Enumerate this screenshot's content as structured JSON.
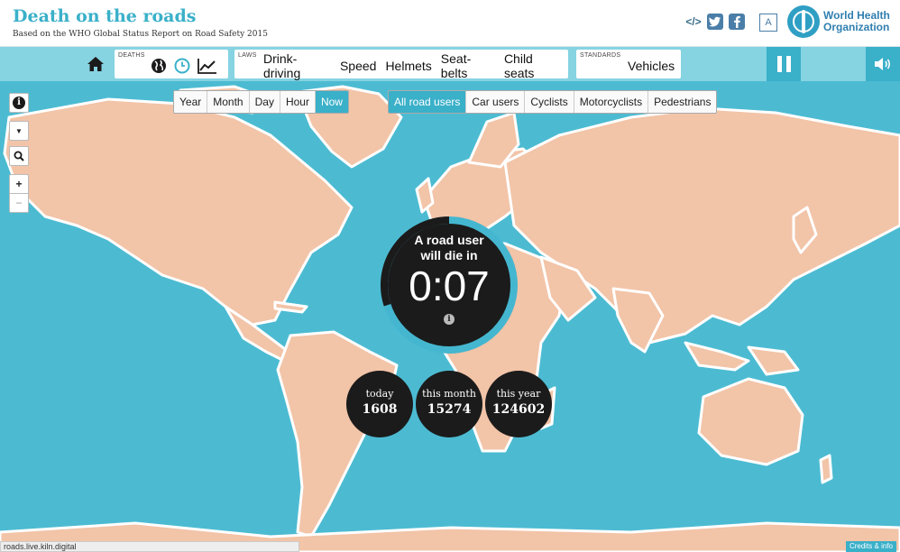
{
  "header": {
    "title": "Death on the roads",
    "subtitle": "Based on the WHO Global Status Report on Road Safety 2015",
    "embed_icon_text": "</>",
    "lang_icon_text": "A",
    "org_name_line1": "World Health",
    "org_name_line2": "Organization"
  },
  "toolbar": {
    "deaths_label": "DEATHS",
    "laws_label": "LAWS",
    "laws": [
      "Drink-driving",
      "Speed",
      "Helmets",
      "Seat-belts",
      "Child seats"
    ],
    "standards_label": "STANDARDS",
    "standards": [
      "Vehicles"
    ]
  },
  "time_filters": [
    "Year",
    "Month",
    "Day",
    "Hour",
    "Now"
  ],
  "time_active": "Now",
  "user_filters": [
    "All road users",
    "Car users",
    "Cyclists",
    "Motorcyclists",
    "Pedestrians"
  ],
  "user_active": "All road users",
  "clock": {
    "line1": "A road user",
    "line2": "will die in",
    "time": "0:07",
    "progress": 0.3
  },
  "stats": [
    {
      "label": "today",
      "value": "1608"
    },
    {
      "label": "this month",
      "value": "15274"
    },
    {
      "label": "this year",
      "value": "124602"
    }
  ],
  "map_controls": {
    "info": "i",
    "filter": "▼",
    "zoom_in": "+",
    "zoom_out": "−"
  },
  "status_url": "roads.live.kiln.digital",
  "credits": "Credits & info",
  "colors": {
    "accent": "#3ab0c9",
    "ocean": "#4cbbd2",
    "land": "#f2c4a8",
    "dark": "#1b1b1b"
  }
}
